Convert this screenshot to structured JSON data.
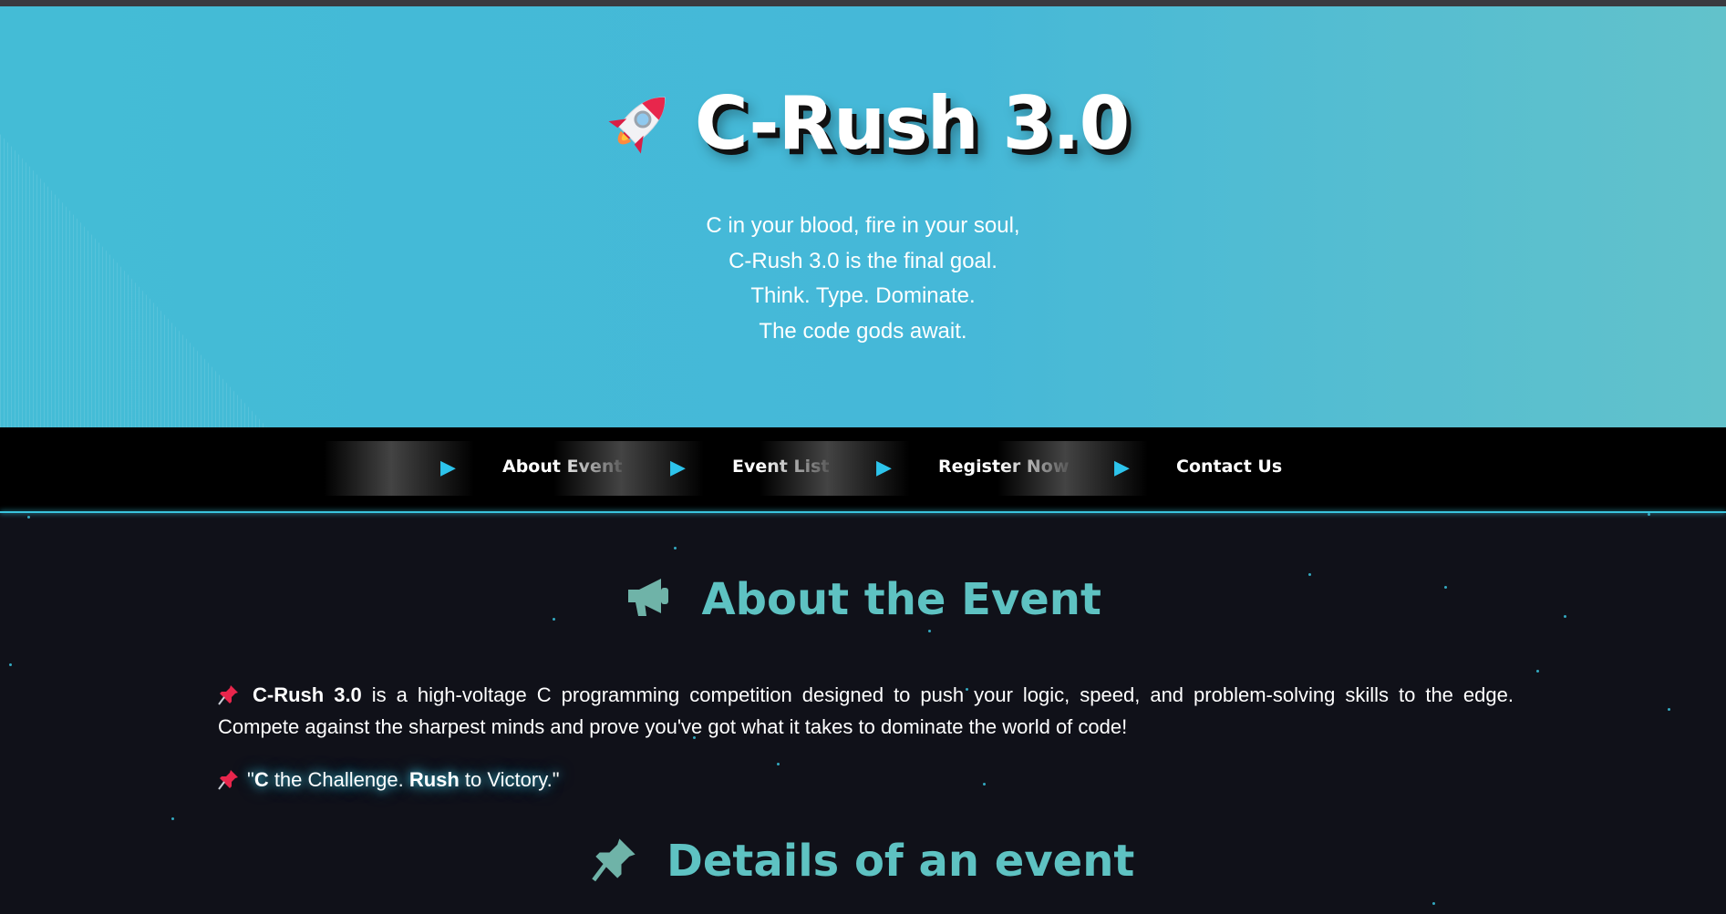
{
  "hero": {
    "title": "C-Rush 3.0",
    "rocket_icon": "rocket-icon",
    "tagline": [
      "C in your blood, fire in your soul,",
      "C-Rush 3.0 is the final goal.",
      "Think. Type. Dominate.",
      "The code gods await."
    ],
    "colors": {
      "gradient_start": "#44bcd6",
      "gradient_end": "#62c2cb"
    }
  },
  "nav": {
    "arrow_icon": "play-arrow-icon",
    "items": [
      {
        "label": "About Event"
      },
      {
        "label": "Event List"
      },
      {
        "label": "Register Now"
      },
      {
        "label": "Contact Us"
      }
    ],
    "accent": "#2dc4ec"
  },
  "about": {
    "heading": "About the Event",
    "heading_icon": "megaphone-icon",
    "paragraph": {
      "pin_icon": "pushpin-icon",
      "strong": "C-Rush 3.0",
      "text": " is a high-voltage C programming competition designed to push your logic, speed, and problem-solving skills to the edge. Compete against the sharpest minds and prove you've got what it takes to dominate the world of code!"
    },
    "quote": {
      "open": "\"",
      "c": "C",
      "mid": " the Challenge. ",
      "rush": "Rush",
      "end": " to Victory.\""
    },
    "heading_color": "#5ec2c2"
  },
  "details": {
    "heading": "Details of an event",
    "heading_icon": "pushpin-icon"
  }
}
